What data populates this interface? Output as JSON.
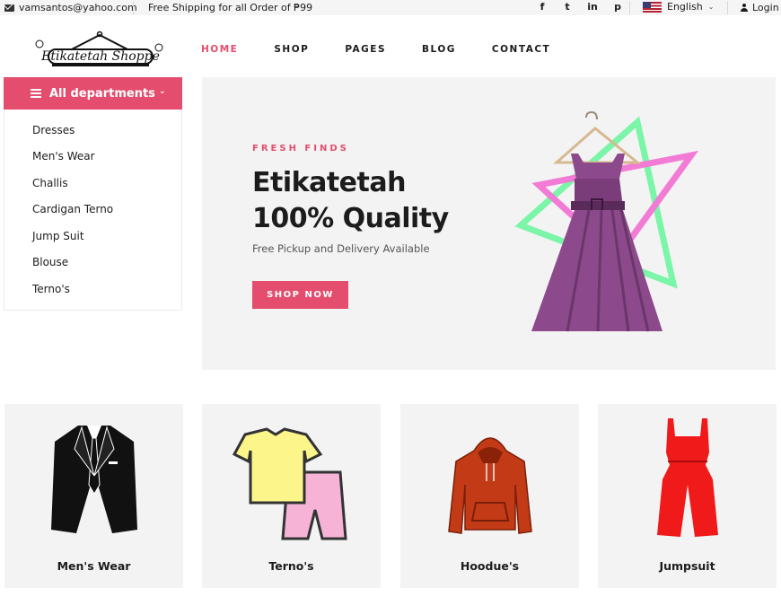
{
  "topbar": {
    "email": "vamsantos@yahoo.com",
    "shipping": "Free Shipping for all Order of ₱99",
    "social": [
      "f",
      "t",
      "in",
      "p"
    ],
    "language": "English",
    "login": "Login"
  },
  "logo": {
    "text": "Etikatetah Shoppe"
  },
  "nav": [
    {
      "label": "HOME",
      "active": true
    },
    {
      "label": "SHOP"
    },
    {
      "label": "PAGES"
    },
    {
      "label": "BLOG"
    },
    {
      "label": "CONTACT"
    }
  ],
  "departments": {
    "title": "All departments",
    "items": [
      "Dresses",
      "Men's Wear",
      "Challis",
      "Cardigan Terno",
      "Jump Suit",
      "Blouse",
      "Terno's"
    ]
  },
  "hero": {
    "kicker": "FRESH FINDS",
    "title_line1": "Etikatetah",
    "title_line2": "100% Quality",
    "subtitle": "Free Pickup and Delivery Available",
    "cta": "SHOP NOW"
  },
  "categories": [
    "Men's Wear",
    "Terno's",
    "Hoodue's",
    "Jumpsuit"
  ],
  "colors": {
    "accent": "#e44d6d",
    "panel": "#f3f3f3"
  }
}
